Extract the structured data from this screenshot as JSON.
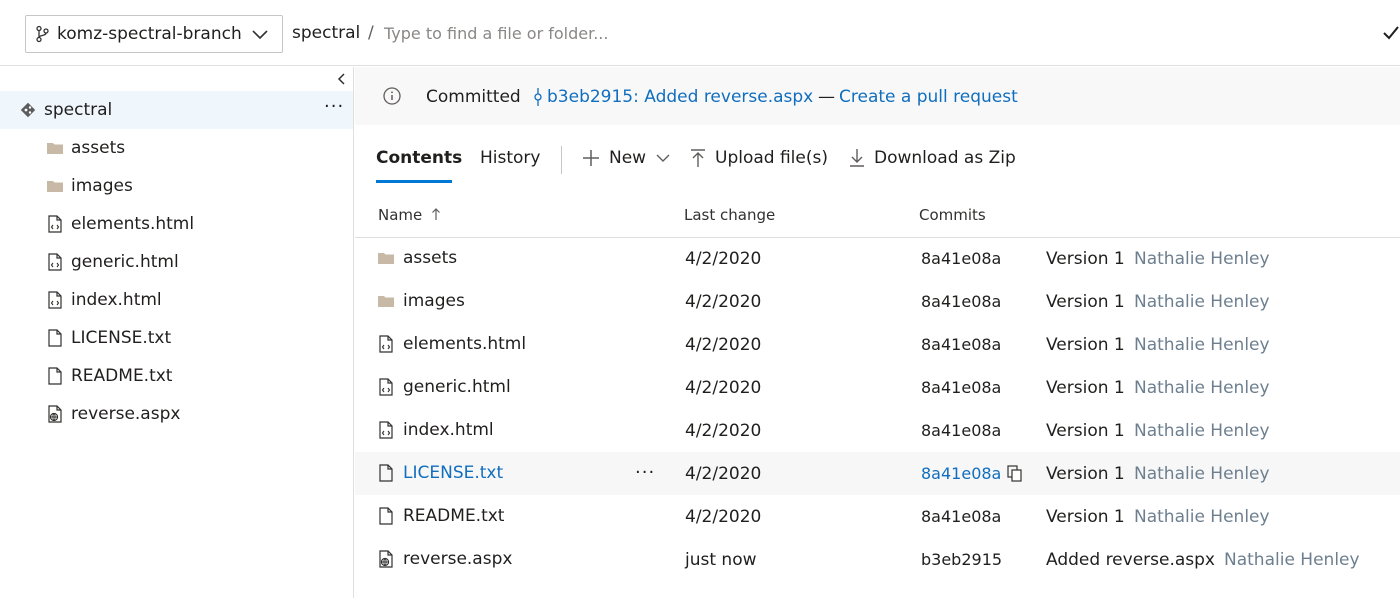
{
  "topbar": {
    "branch": "komz-spectral-branch",
    "repo": "spectral",
    "separator": "/",
    "path_placeholder": "Type to find a file or folder..."
  },
  "sidebar": {
    "root": {
      "label": "spectral",
      "more": "···"
    },
    "items": [
      {
        "label": "assets",
        "icon": "folder-icon"
      },
      {
        "label": "images",
        "icon": "folder-icon"
      },
      {
        "label": "elements.html",
        "icon": "code-file-icon"
      },
      {
        "label": "generic.html",
        "icon": "code-file-icon"
      },
      {
        "label": "index.html",
        "icon": "code-file-icon"
      },
      {
        "label": "LICENSE.txt",
        "icon": "text-file-icon"
      },
      {
        "label": "README.txt",
        "icon": "text-file-icon"
      },
      {
        "label": "reverse.aspx",
        "icon": "web-file-icon"
      }
    ]
  },
  "banner": {
    "committed": "Committed",
    "commit_link": "b3eb2915: Added reverse.aspx",
    "separator": "—",
    "pr_link": "Create a pull request"
  },
  "tabs": {
    "contents": "Contents",
    "history": "History",
    "new": "New",
    "upload": "Upload file(s)",
    "download": "Download as Zip"
  },
  "table": {
    "headers": {
      "name": "Name",
      "last_change": "Last change",
      "commits": "Commits"
    },
    "rows": [
      {
        "name": "assets",
        "icon": "folder-icon",
        "date": "4/2/2020",
        "hash": "8a41e08a",
        "message": "Version 1",
        "author": "Nathalie Henley"
      },
      {
        "name": "images",
        "icon": "folder-icon",
        "date": "4/2/2020",
        "hash": "8a41e08a",
        "message": "Version 1",
        "author": "Nathalie Henley"
      },
      {
        "name": "elements.html",
        "icon": "code-file-icon",
        "date": "4/2/2020",
        "hash": "8a41e08a",
        "message": "Version 1",
        "author": "Nathalie Henley"
      },
      {
        "name": "generic.html",
        "icon": "code-file-icon",
        "date": "4/2/2020",
        "hash": "8a41e08a",
        "message": "Version 1",
        "author": "Nathalie Henley"
      },
      {
        "name": "index.html",
        "icon": "code-file-icon",
        "date": "4/2/2020",
        "hash": "8a41e08a",
        "message": "Version 1",
        "author": "Nathalie Henley"
      },
      {
        "name": "LICENSE.txt",
        "icon": "text-file-icon",
        "date": "4/2/2020",
        "hash": "8a41e08a",
        "message": "Version 1",
        "author": "Nathalie Henley",
        "more": "···"
      },
      {
        "name": "README.txt",
        "icon": "text-file-icon",
        "date": "4/2/2020",
        "hash": "8a41e08a",
        "message": "Version 1",
        "author": "Nathalie Henley"
      },
      {
        "name": "reverse.aspx",
        "icon": "web-file-icon",
        "date": "just now",
        "hash": "b3eb2915",
        "message": "Added reverse.aspx",
        "author": "Nathalie Henley"
      }
    ]
  },
  "colors": {
    "accent": "#0078d4",
    "link": "#106ebe",
    "author": "#6d7f8f",
    "selected_bg": "#eff6fc",
    "banner_bg": "#f8f8f8"
  }
}
